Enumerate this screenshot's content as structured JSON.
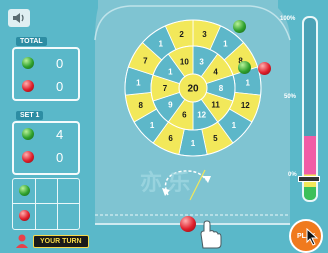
{
  "scoreboard": {
    "total_label": "TOTAL",
    "total_green": "0",
    "total_red": "0",
    "set_label": "SET 1",
    "set_green": "4",
    "set_red": "0",
    "turn_label": "YOUR TURN"
  },
  "dartboard": {
    "center": "20",
    "inner_ring": [
      "3",
      "4",
      "8",
      "11",
      "12",
      "6",
      "9",
      "7",
      "1",
      "10"
    ],
    "outer_ring": [
      "3",
      "1",
      "8",
      "1",
      "12",
      "1",
      "5",
      "1",
      "6",
      "1",
      "8",
      "1",
      "7",
      "1",
      "2"
    ]
  },
  "power_meter": {
    "max_label": "100%",
    "mid_label": "50%",
    "min_label": "0%",
    "level": 0.35
  },
  "play_button_label": "PLAY",
  "colors": {
    "board_yellow": "#f2e85a",
    "board_blue": "#5db7c9",
    "accent_orange": "#f07a1e"
  }
}
